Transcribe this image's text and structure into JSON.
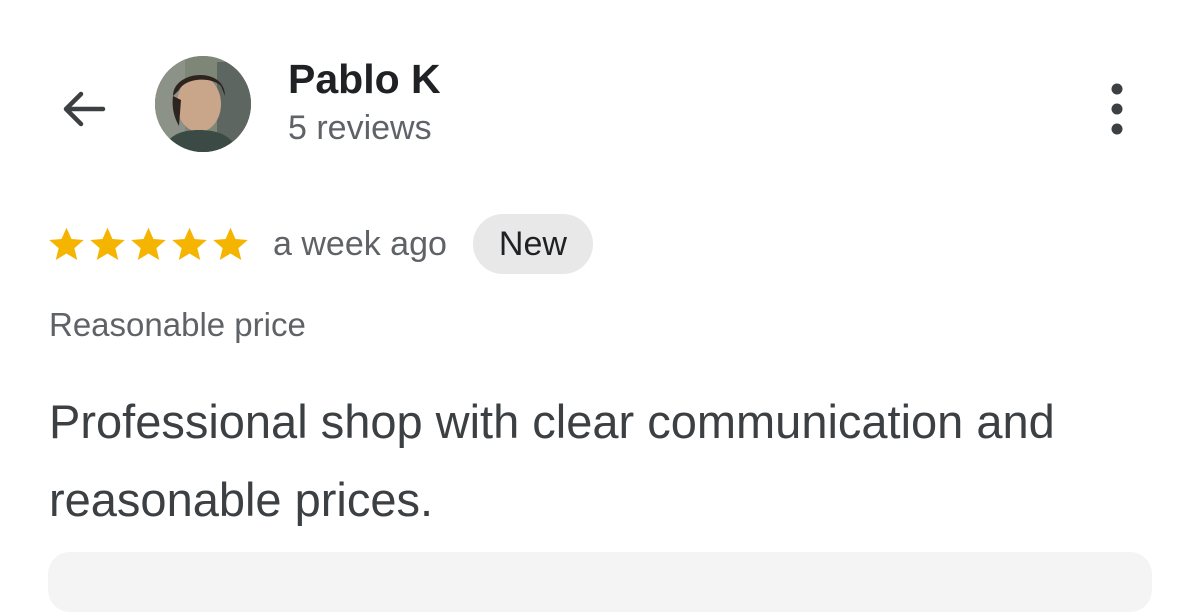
{
  "header": {
    "back_icon": "arrow-back-icon",
    "author_name": "Pablo K",
    "review_count": "5 reviews",
    "more_icon": "more-vert-icon"
  },
  "review": {
    "rating": 5,
    "max_rating": 5,
    "star_color": "#f4b400",
    "time_ago": "a week ago",
    "badge": "New",
    "attribute": "Reasonable price",
    "text": "Professional shop with clear communication and reasonable prices."
  },
  "colors": {
    "primary_text": "#202124",
    "secondary_text": "#5f6368",
    "badge_background": "#e8e8e8"
  }
}
